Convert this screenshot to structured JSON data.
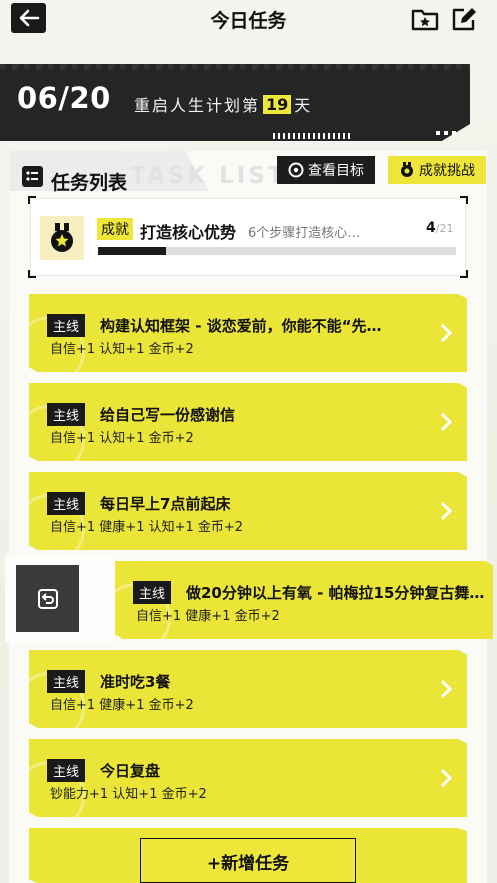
{
  "header": {
    "title": "今日任务"
  },
  "banner": {
    "date": "06/20",
    "text_before": "重启人生计划第",
    "day_number": "19",
    "text_after": "天"
  },
  "list": {
    "title": "任务列表",
    "watermark": "TASK LIST",
    "view_goal_label": "查看目标",
    "challenge_label": "成就挑战"
  },
  "achievement": {
    "tag": "成就",
    "title": "打造核心优势",
    "desc": "6个步骤打造核心…",
    "progress_current": "4",
    "progress_total": "/21",
    "progress_fraction": 0.19
  },
  "tasks": [
    {
      "tag": "主线",
      "title": "构建认知框架 - 谈恋爱前，你能不能“先…",
      "rewards": "自信+1  认知+1  金币+2"
    },
    {
      "tag": "主线",
      "title": "给自己写一份感谢信",
      "rewards": "自信+1  认知+1  金币+2"
    },
    {
      "tag": "主线",
      "title": "每日早上7点前起床",
      "rewards": "自信+1  健康+1  认知+1  金币+2"
    },
    {
      "tag": "主线",
      "title": "做20分钟以上有氧 - 帕梅拉15分钟复古舞…",
      "rewards": "自信+1  健康+1  金币+2"
    },
    {
      "tag": "主线",
      "title": "准时吃3餐",
      "rewards": "自信+1  健康+1  金币+2"
    },
    {
      "tag": "主线",
      "title": "今日复盘",
      "rewards": "钞能力+1  认知+1  金币+2"
    }
  ],
  "footer": {
    "add_label": "+新增任务"
  },
  "colors": {
    "accent_yellow": "#ebe538",
    "dark": "#1a1a1a"
  }
}
